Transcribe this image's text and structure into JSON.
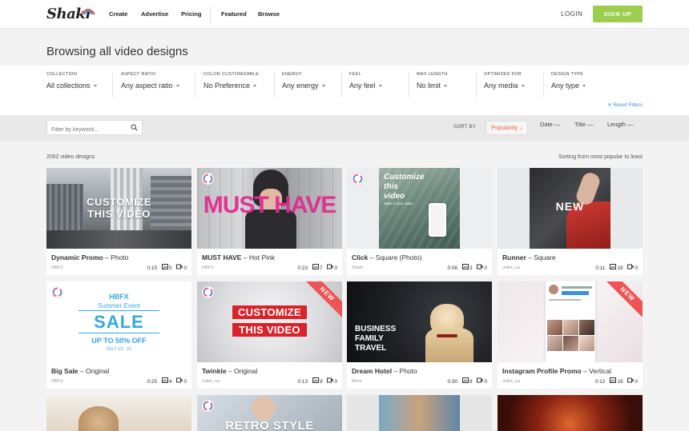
{
  "header": {
    "logo": "Shakr",
    "nav": [
      "Create",
      "Advertise",
      "Pricing",
      "Featured",
      "Browse"
    ],
    "login": "LOGIN",
    "signup": "SIGN UP"
  },
  "page_title": "Browsing all video designs",
  "filters": [
    {
      "label": "COLLECTION",
      "value": "All collections"
    },
    {
      "label": "ASPECT RATIO",
      "value": "Any aspect ratio"
    },
    {
      "label": "COLOR CUSTOMIZABLE",
      "value": "No Preference"
    },
    {
      "label": "ENERGY",
      "value": "Any energy"
    },
    {
      "label": "FEEL",
      "value": "Any feel"
    },
    {
      "label": "MAX LENGTH",
      "value": "No limit"
    },
    {
      "label": "OPTIMIZED FOR",
      "value": "Any media"
    },
    {
      "label": "DESIGN TYPE",
      "value": "Any type"
    }
  ],
  "reset_filters": "✕ Reset Filters",
  "search": {
    "placeholder": "Filter by keyword..."
  },
  "sort": {
    "label": "SORT BY",
    "options": [
      {
        "label": "Popularity",
        "indicator": "↓",
        "active": true
      },
      {
        "label": "Date",
        "indicator": "—",
        "active": false
      },
      {
        "label": "Title",
        "indicator": "—",
        "active": false
      },
      {
        "label": "Length",
        "indicator": "—",
        "active": false
      }
    ]
  },
  "results": {
    "count": "2062 video designs",
    "sort_note": "Sorting from most popular to least"
  },
  "cards": [
    {
      "name": "Dynamic Promo",
      "type": "Photo",
      "author": "HBFX",
      "duration": "0:15",
      "photos": "5",
      "videos": "0",
      "overlay": [
        "CUSTOMIZE",
        "THIS VIDEO"
      ],
      "badge": false,
      "new": false
    },
    {
      "name": "MUST HAVE",
      "type": "Hot Pink",
      "author": "HBFX",
      "duration": "0:23",
      "photos": "7",
      "videos": "0",
      "overlay": [
        "MUST HAVE"
      ],
      "badge": true,
      "new": false
    },
    {
      "name": "Click",
      "type": "Square (Photo)",
      "author": "Shakr",
      "duration": "0:06",
      "photos": "3",
      "videos": "0",
      "overlay": [
        "Customize",
        "this",
        "video",
        "Make it your video"
      ],
      "badge": true,
      "new": false
    },
    {
      "name": "Runner",
      "type": "Square",
      "author": "Juliet_ua",
      "duration": "0:11",
      "photos": "18",
      "videos": "0",
      "overlay": [
        "NEW"
      ],
      "badge": false,
      "new": false
    },
    {
      "name": "Big Sale",
      "type": "Original",
      "author": "HBFX",
      "duration": "0:25",
      "photos": "4",
      "videos": "0",
      "overlay": [
        "HBFX",
        "Summer Event",
        "SALE",
        "UP TO 50% OFF",
        "JULY 13 - 21"
      ],
      "badge": true,
      "new": false
    },
    {
      "name": "Twinkle",
      "type": "Original",
      "author": "Juliet_ua",
      "duration": "0:13",
      "photos": "9",
      "videos": "0",
      "overlay": [
        "CUSTOMIZE",
        "THIS VIDEO"
      ],
      "badge": true,
      "new": true
    },
    {
      "name": "Dream Hotel",
      "type": "Photo",
      "author": "Biree",
      "duration": "0:30",
      "photos": "8",
      "videos": "0",
      "overlay": [
        "BUSINESS",
        "FAMILY",
        "TRAVEL"
      ],
      "badge": false,
      "new": false
    },
    {
      "name": "Instagram Profile Promo",
      "type": "Vertical",
      "author": "Juliet_ua",
      "duration": "0:12",
      "photos": "16",
      "videos": "0",
      "overlay": [],
      "badge": false,
      "new": true
    }
  ],
  "partial_row": {
    "overlay": "RETRO STYLE"
  },
  "new_label": "NEW",
  "icons": [
    "search-icon",
    "photo-icon",
    "video-icon",
    "brand-badge-icon",
    "caret-down-icon",
    "logo-mark-icon"
  ],
  "colors": {
    "accent_green": "#9ccd4f",
    "active_sort": "#e85b4b",
    "link_blue": "#3a8ee0",
    "ribbon_red": "#ef5454",
    "pink": "#e3288f",
    "sky": "#33a9e0"
  }
}
